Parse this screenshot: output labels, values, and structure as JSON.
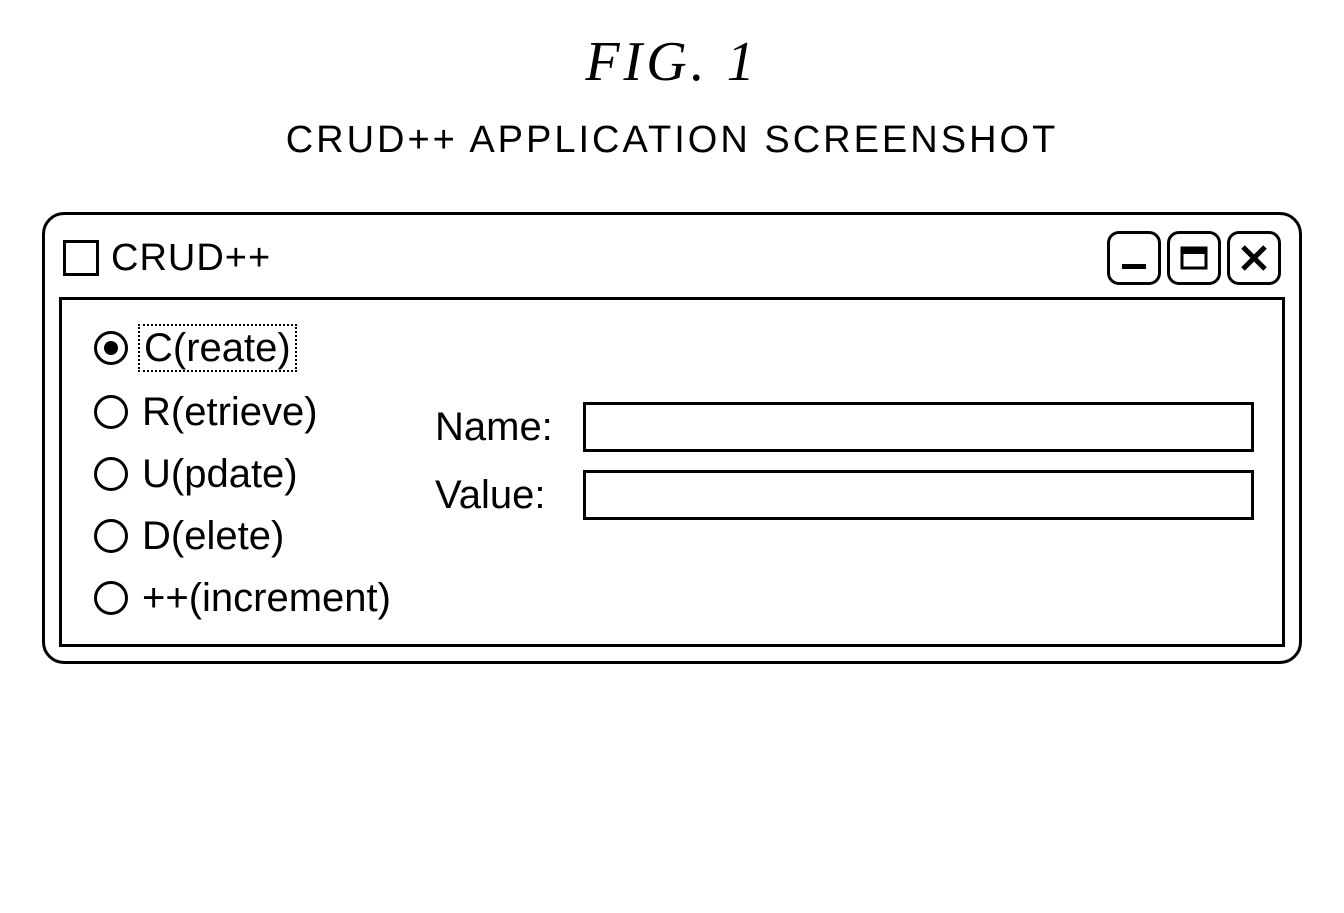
{
  "figure_title": "FIG.  1",
  "caption": "CRUD++  APPLICATION  SCREENSHOT",
  "window": {
    "title": "CRUD++"
  },
  "radios": [
    {
      "label": "C(reate)",
      "selected": true,
      "focused": true
    },
    {
      "label": "R(etrieve)",
      "selected": false,
      "focused": false
    },
    {
      "label": "U(pdate)",
      "selected": false,
      "focused": false
    },
    {
      "label": "D(elete)",
      "selected": false,
      "focused": false
    },
    {
      "label": "++(increment)",
      "selected": false,
      "focused": false
    }
  ],
  "form": {
    "name_label": "Name:",
    "name_value": "",
    "value_label": "Value:",
    "value_value": ""
  }
}
